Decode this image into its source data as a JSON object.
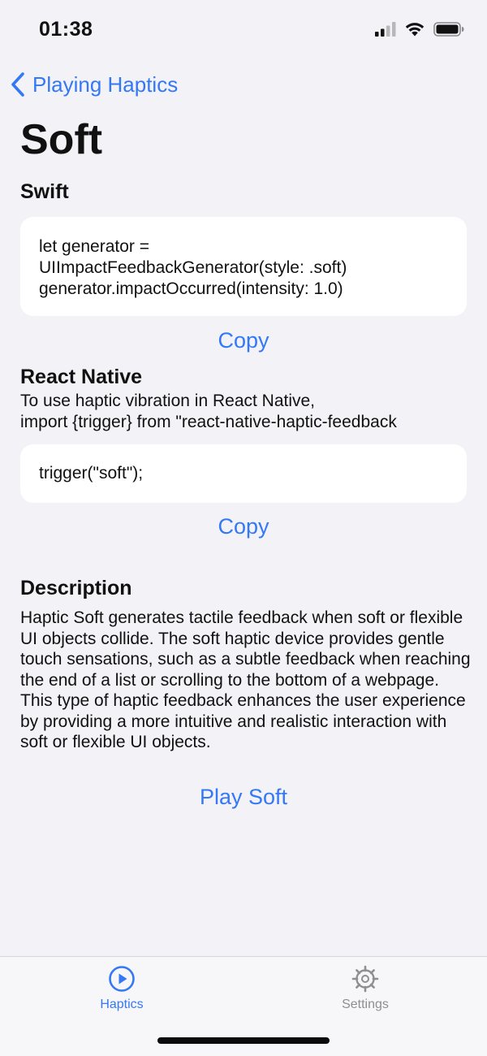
{
  "status_bar": {
    "time": "01:38"
  },
  "nav": {
    "back_label": "Playing Haptics"
  },
  "page": {
    "title": "Soft"
  },
  "swift_section": {
    "heading": "Swift",
    "code": "let generator =\nUIImpactFeedbackGenerator(style: .soft)\ngenerator.impactOccurred(intensity: 1.0)",
    "copy_label": "Copy"
  },
  "react_native_section": {
    "heading": "React Native",
    "intro": "To use haptic vibration in React Native,\nimport {trigger} from \"react-native-haptic-feedback",
    "code": "trigger(\"soft\");",
    "copy_label": "Copy"
  },
  "description_section": {
    "heading": "Description",
    "text": "Haptic Soft generates tactile feedback when soft or flexible UI objects collide. The soft haptic device provides gentle touch sensations, such as a subtle feedback when reaching the end of a list or scrolling to the bottom of a webpage. This type of haptic feedback enhances the user experience by providing a more intuitive and realistic interaction with soft or flexible UI objects.",
    "play_label": "Play Soft"
  },
  "tab_bar": {
    "tabs": [
      {
        "label": "Haptics",
        "icon": "play-circle-icon",
        "active": true
      },
      {
        "label": "Settings",
        "icon": "gear-icon",
        "active": false
      }
    ]
  },
  "colors": {
    "accent": "#3478f6",
    "background": "#f2f2f7",
    "card": "#ffffff",
    "inactive_tab": "#8e8e93"
  }
}
